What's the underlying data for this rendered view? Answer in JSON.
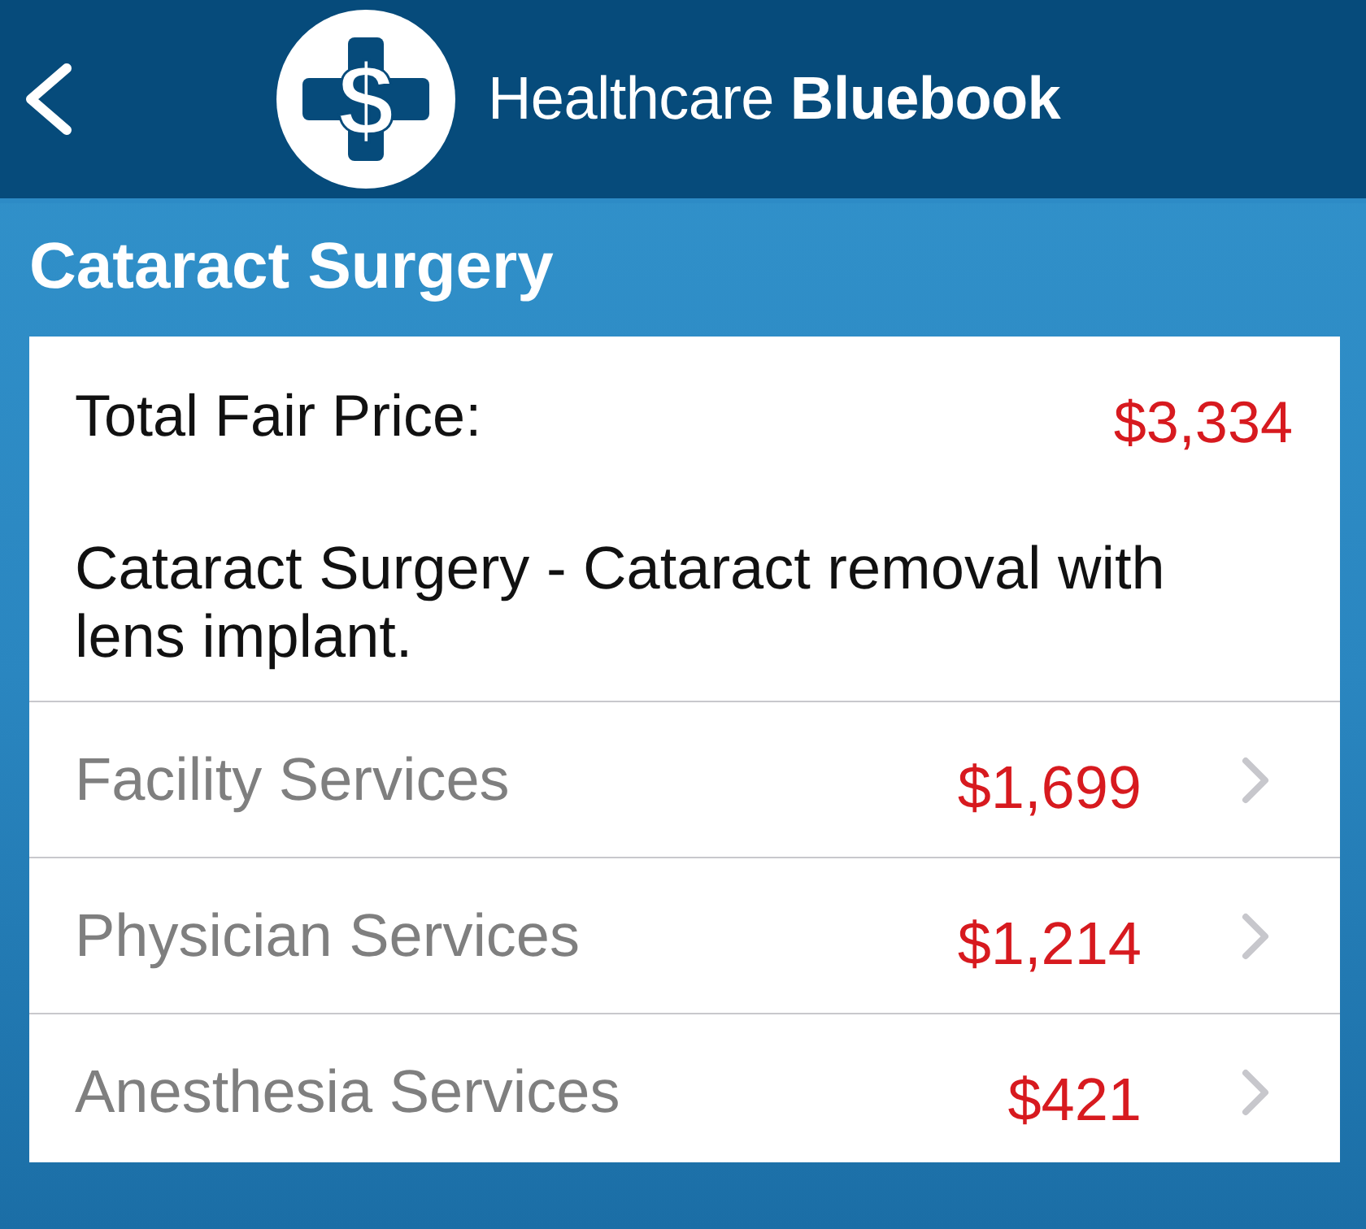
{
  "header": {
    "logo_symbol": "$",
    "brand": "Healthcare **Bluebook**"
  },
  "title": "Cataract Surgery",
  "summary": {
    "label": "Total Fair Price:",
    "price": "$3,334",
    "description": "Cataract Surgery - Cataract removal with lens implant."
  },
  "services": [
    {
      "label": "Facility Services",
      "price": "$1,699"
    },
    {
      "label": "Physician Services",
      "price": "$1,214"
    },
    {
      "label": "Anesthesia Services",
      "price": "$421"
    }
  ]
}
